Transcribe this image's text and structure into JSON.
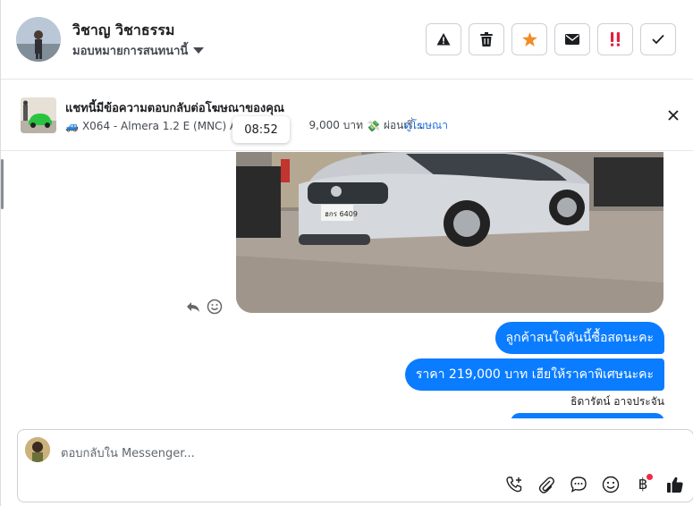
{
  "header": {
    "contact_name": "วิชาญ วิชาธรรม",
    "assign_label": "มอบหมายการสนทนานี้",
    "actions": [
      {
        "icon": "warning-icon",
        "color": "#1c1e21"
      },
      {
        "icon": "trash-icon",
        "color": "#1c1e21"
      },
      {
        "icon": "star-icon",
        "color": "#f28c28"
      },
      {
        "icon": "mail-icon",
        "color": "#1c1e21"
      },
      {
        "icon": "urgent-icon",
        "color": "#e41e3f"
      },
      {
        "icon": "check-icon",
        "color": "#1c1e21"
      }
    ]
  },
  "ad_banner": {
    "title": "แชทนี้มีข้อความตอบกลับต่อโฆษณาของคุณ",
    "car_emoji": "🚙",
    "description_before": "X064 - Almera 1.2 E (MNC) AT",
    "description_after": "9,000 บาท",
    "money_emoji": "💸",
    "description_tail": "ผ่อนเริ่...",
    "link_label": "ดูโฆษณา",
    "tooltip_time": "08:52"
  },
  "thread": {
    "photo_plate": "ฮกร 6409",
    "messages": [
      {
        "text": "ลูกค้าสนใจคันนี้ซื้อสดนะคะ"
      },
      {
        "text": "ราคา 219,000 บาท เฮียให้ราคาพิเศษนะคะ"
      }
    ],
    "sender_name": "ธิดารัตน์ อาจประจัน"
  },
  "composer": {
    "placeholder": "ตอบกลับใน Messenger...",
    "currency_symbol": "฿"
  },
  "colors": {
    "accent": "#0a7cff",
    "link": "#216fdb",
    "star": "#f28c28",
    "urgent": "#e41e3f",
    "notification_dot": "#f02849"
  }
}
